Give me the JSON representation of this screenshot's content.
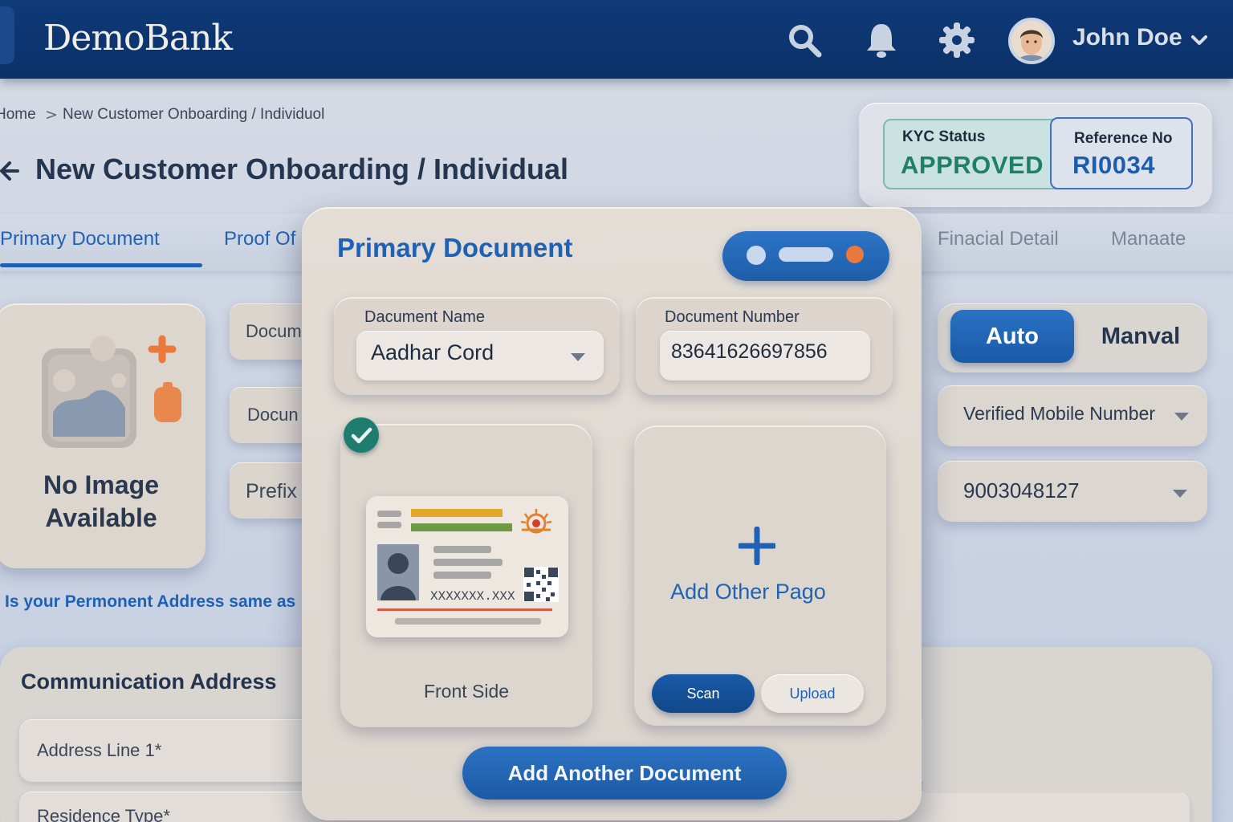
{
  "header": {
    "brand": "DemoBank",
    "user_name": "John Doe",
    "icons": [
      "search-icon",
      "bell-icon",
      "gear-icon",
      "avatar",
      "chevron-down-icon"
    ]
  },
  "breadcrumb": {
    "home": "Home",
    "separator": ">",
    "current": "New Customer Onboarding / Individuol"
  },
  "page": {
    "title": "New Customer Onboarding / Individual"
  },
  "status": {
    "kyc_label": "KYC Status",
    "kyc_value": "APPROVED",
    "ref_label": "Reference No",
    "ref_value": "RI0034"
  },
  "tabs": [
    {
      "label": "Primary Document",
      "active": true
    },
    {
      "label": "Proof Of",
      "active": false
    },
    {
      "label": "Finacial Detail",
      "active": false
    },
    {
      "label": "Manaate",
      "active": false
    }
  ],
  "left_panel": {
    "no_image": "No Image Available",
    "fields": [
      "Docum",
      "Docun",
      "Prefix"
    ],
    "permanent_question": "Is your Permonent Address same as"
  },
  "communication": {
    "title": "Communication Address",
    "address_line_1": "Address Line 1*",
    "residence_type": "Residence Type*"
  },
  "right_panel": {
    "toggle_auto": "Auto",
    "toggle_manual": "Manval",
    "verified_mobile_label": "Verified Mobile Number",
    "mobile_value": "9003048127"
  },
  "modal": {
    "title": "Primary Document",
    "doc_name_label": "Dacument Name",
    "doc_name_value": "Aadhar Cord",
    "doc_number_label": "Document Number",
    "doc_number_value": "83641626697856",
    "card_number_mask": "XXXXXXX.XXX",
    "front_side_label": "Front Side",
    "add_page_label": "Add Other Pago",
    "scan_label": "Scan",
    "upload_label": "Upload",
    "add_another_label": "Add Another Document"
  },
  "colors": {
    "header_bg": "#0f3a78",
    "accent_blue": "#1f62b5",
    "approved_green": "#1e7f6a",
    "check_green": "#1f7d70",
    "orange": "#e9793d"
  }
}
